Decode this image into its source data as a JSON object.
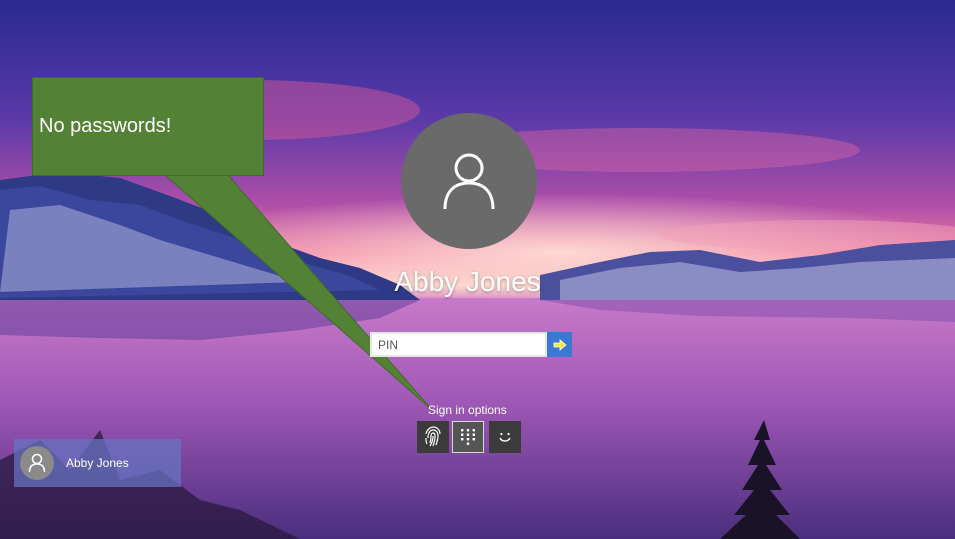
{
  "colors": {
    "callout_green": "#538135",
    "submit_blue": "#3a78d4",
    "tile_blue": "#6775c4"
  },
  "lockscreen": {
    "username": "Abby Jones",
    "pin_placeholder": "PIN",
    "submit_icon": "arrow-right-icon",
    "signin_options_label": "Sign in options",
    "signin_options": [
      {
        "icon": "fingerprint-icon"
      },
      {
        "icon": "pin-keypad-icon",
        "selected": true
      },
      {
        "icon": "face-recognition-icon"
      }
    ]
  },
  "callout": {
    "text": "No passwords!"
  },
  "user_switcher": {
    "username": "Abby Jones",
    "icon": "user-avatar-icon"
  }
}
